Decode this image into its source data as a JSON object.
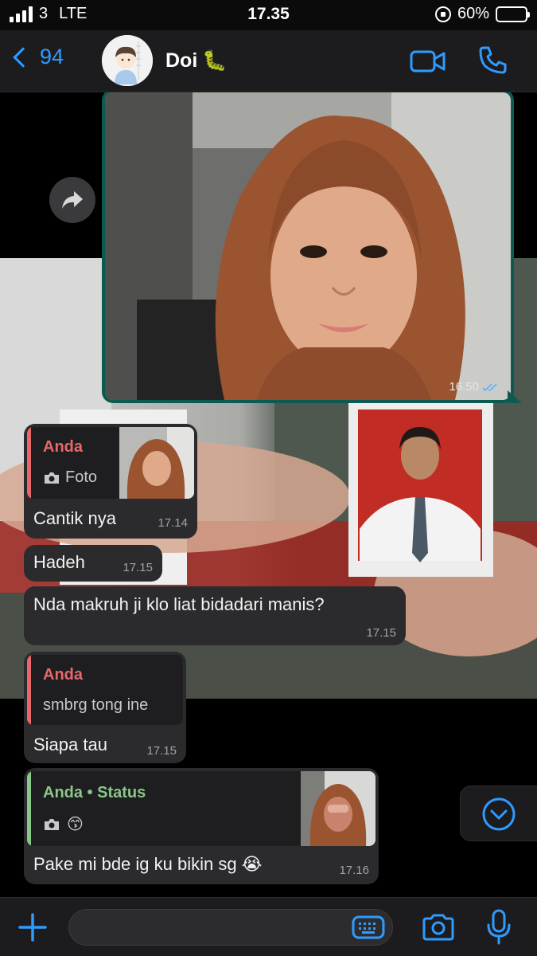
{
  "status_bar": {
    "carrier": "3",
    "network": "LTE",
    "time": "17.35",
    "battery": "60%",
    "battery_level": 0.6
  },
  "header": {
    "back_count": "94",
    "contact_name": "Doi",
    "contact_emoji": "🐛"
  },
  "image_message": {
    "time": "16.50"
  },
  "messages": [
    {
      "quote_author": "Anda",
      "quote_body": "Foto",
      "text": "Cantik nya",
      "time": "17.14"
    },
    {
      "text": "Hadeh",
      "time": "17.15"
    },
    {
      "text": "Nda makruh ji klo liat bidadari manis?",
      "time": "17.15"
    },
    {
      "quote_author": "Anda",
      "quote_body": "smbrg tong ine",
      "text": "Siapa tau",
      "time": "17.15"
    },
    {
      "quote_author": "Anda • Status",
      "quote_body": "😙",
      "text": "Pake mi bde ig ku bikin sg 😭",
      "time": "17.16"
    }
  ],
  "input": {
    "value": "",
    "placeholder": ""
  },
  "colors": {
    "accent": "#2f9bff",
    "bubble": "#2b2b2d",
    "outgoing": "#0c5a52",
    "quote_red": "#e8676b",
    "quote_green": "#8bc68a"
  },
  "icons": [
    "video-icon",
    "phone-icon",
    "forward-icon",
    "camera-icon",
    "chevron-down-icon",
    "plus-icon",
    "keyboard-icon",
    "mic-icon"
  ]
}
